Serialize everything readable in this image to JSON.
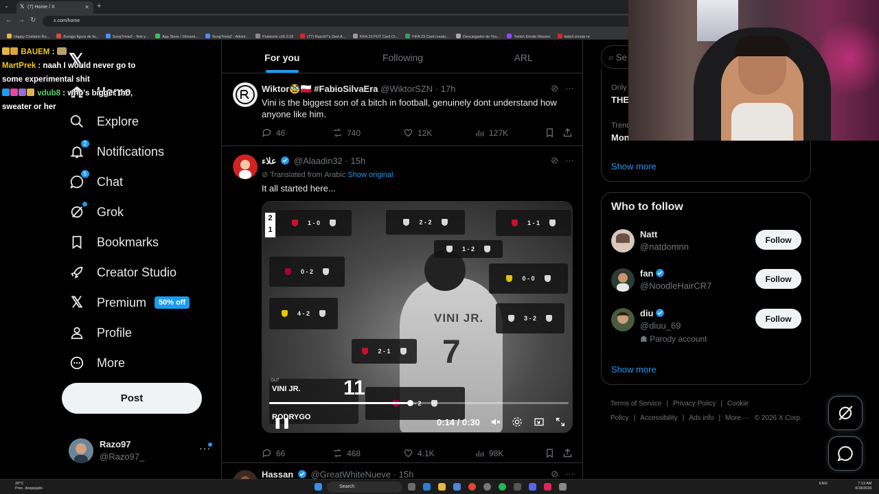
{
  "browser": {
    "tab_title": "(7) Home / X",
    "url": "x.com/home",
    "bookmarks": [
      {
        "label": "Happy Cristiano Ro...",
        "color": "#e8b53a"
      },
      {
        "label": "Burago figura de fa...",
        "color": "#d84a3a"
      },
      {
        "label": "SongTrivia2 - Test y...",
        "color": "#4b8df8"
      },
      {
        "label": "App Store / Streami...",
        "color": "#37c05a"
      },
      {
        "label": "SongTrivia2 - Advini...",
        "color": "#4b8df8"
      },
      {
        "label": "Paletools v26.0.28",
        "color": "#888888"
      },
      {
        "label": "(77) Razo97's Zest-A...",
        "color": "#d4291c"
      },
      {
        "label": "FIFA 23 PUT Card Cr...",
        "color": "#999999"
      },
      {
        "label": "FIFA 23 Card creato...",
        "color": "#3a9a6a"
      },
      {
        "label": "Descargador de You...",
        "color": "#aaaaaa"
      },
      {
        "label": "Twitch Emote Resizer",
        "color": "#9146ff"
      },
      {
        "label": "twitch emote re",
        "color": "#d4291c"
      }
    ]
  },
  "chat": [
    {
      "user": "BAUEM",
      "text": ""
    },
    {
      "user": "MartPrek",
      "text": "naah I would never go to some experimental shit"
    },
    {
      "user": "vdub8",
      "text": "who's bigger tho, sweater or her"
    }
  ],
  "nav": {
    "home": "Home",
    "explore": "Explore",
    "notifications": "Notifications",
    "notifications_badge": "2",
    "chat": "Chat",
    "chat_badge": "5",
    "grok": "Grok",
    "bookmarks": "Bookmarks",
    "creator_studio": "Creator Studio",
    "premium": "Premium",
    "premium_badge": "50% off",
    "profile": "Profile",
    "more": "More",
    "post_label": "Post",
    "account_name": "Razo97",
    "account_handle": "@Razo97_"
  },
  "feed_tabs": [
    "For you",
    "Following",
    "ARL"
  ],
  "tweets": [
    {
      "name": "Wiktor🥸🇵🇱 #FabioSilvaEra",
      "handle": "@WiktorSZN",
      "time": "17h",
      "text": "Vini is the biggest son of a bitch in football, genuinely dont understand how anyone like him.",
      "replies": "46",
      "reposts": "740",
      "likes": "12K",
      "views": "127K"
    },
    {
      "name": "ﻋﻼﺀ",
      "handle": "@Alaadin32",
      "time": "15h",
      "translated": "Translated from Arabic",
      "show_original": "Show original",
      "text": "It all started here...",
      "replies": "66",
      "reposts": "468",
      "likes": "4.1K",
      "views": "98K"
    },
    {
      "name": "Hassan",
      "handle": "@GreatWhiteNueve",
      "time": "15h"
    }
  ],
  "video": {
    "elapsed": "0:14",
    "duration": "0:30",
    "progress": 0.47,
    "rank_top": "2",
    "rank_bottom": "1",
    "sub_out_label": "OUT",
    "sub_out_name": "VINI JR.",
    "sub_in_name": "RODRYGO",
    "sub_number": "11",
    "jersey_name": "VINI JR.",
    "jersey_number": "7",
    "scores": [
      "1 - 0",
      "2 - 2",
      "1 - 1",
      "1 - 2",
      "0 - 2",
      "0 - 0",
      "4 - 2",
      "3 - 2",
      "2 - 1",
      "1 - 2"
    ]
  },
  "sidebar": {
    "search_placeholder": "Se",
    "trend_small_1": "Only",
    "trend_bold_1": "THE",
    "trend_small_2": "Trend",
    "trend_bold_2": "Mon",
    "show_more": "Show more",
    "who_to_follow_title": "Who to follow",
    "follow_label": "Follow",
    "suggestions": [
      {
        "name": "Natt",
        "handle": "@natdomnn",
        "verified": false,
        "note": ""
      },
      {
        "name": "fan",
        "handle": "@NoodleHairCR7",
        "verified": true,
        "note": ""
      },
      {
        "name": "diu",
        "handle": "@diuu_69",
        "verified": true,
        "note": "Parody account"
      }
    ],
    "footer": [
      "Terms of Service",
      "|",
      "Privacy Policy",
      "|",
      "Cookie Policy",
      "|",
      "Accessibility",
      "|",
      "Ads info",
      "|",
      "More ···",
      "© 2026 X Corp."
    ]
  },
  "taskbar": {
    "temp": "20°C",
    "weather": "Prec. despejado",
    "search": "Search",
    "lang": "ENG",
    "time": "7:13 AM",
    "date": "4/18/2026"
  },
  "colors": {
    "accent": "#1d9bf0",
    "background": "#000000",
    "border": "#2f3336",
    "muted": "#71767b"
  }
}
